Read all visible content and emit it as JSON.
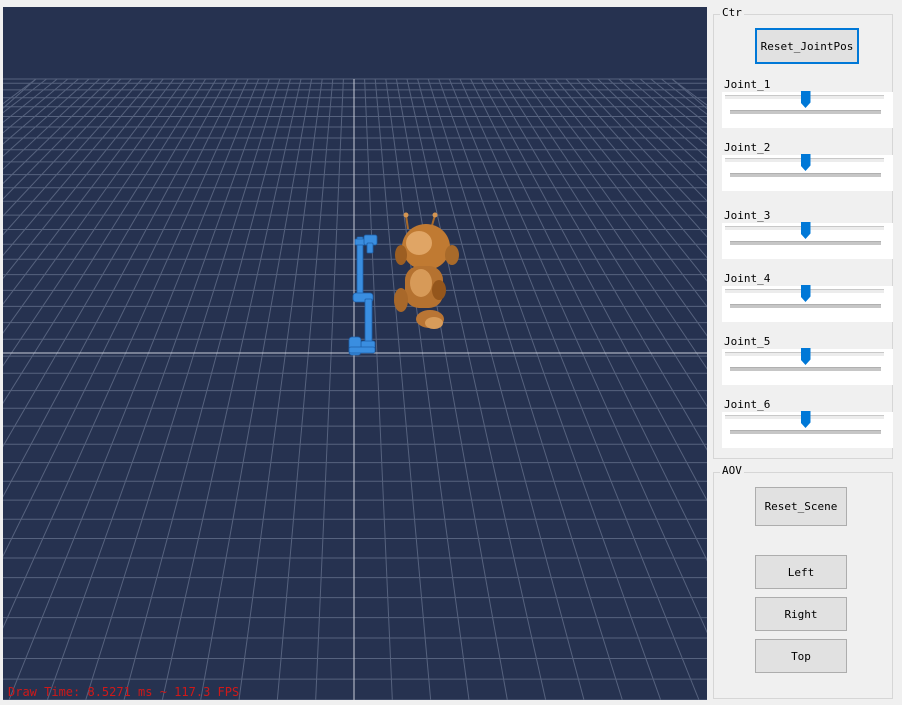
{
  "viewport": {
    "status_text": "Draw Time: 8.5271 ms ~ 117.3 FPS",
    "background_color": "#263250",
    "grid_color": "#56627e",
    "axis_color": "#c8ccd8",
    "robot_color": "#3a8ee0",
    "model_color": "#c07a32"
  },
  "ctr": {
    "title": "Ctr",
    "reset_joint_label": "Reset_JointPos",
    "joints": [
      {
        "label": "Joint_1",
        "value_fraction": 0.5
      },
      {
        "label": "Joint_2",
        "value_fraction": 0.5
      },
      {
        "label": "Joint_3",
        "value_fraction": 0.5
      },
      {
        "label": "Joint_4",
        "value_fraction": 0.5
      },
      {
        "label": "Joint_5",
        "value_fraction": 0.5
      },
      {
        "label": "Joint_6",
        "value_fraction": 0.5
      }
    ]
  },
  "aov": {
    "title": "AOV",
    "reset_scene_label": "Reset_Scene",
    "left_label": "Left",
    "right_label": "Right",
    "top_label": "Top"
  },
  "accent_color": "#0078d7"
}
